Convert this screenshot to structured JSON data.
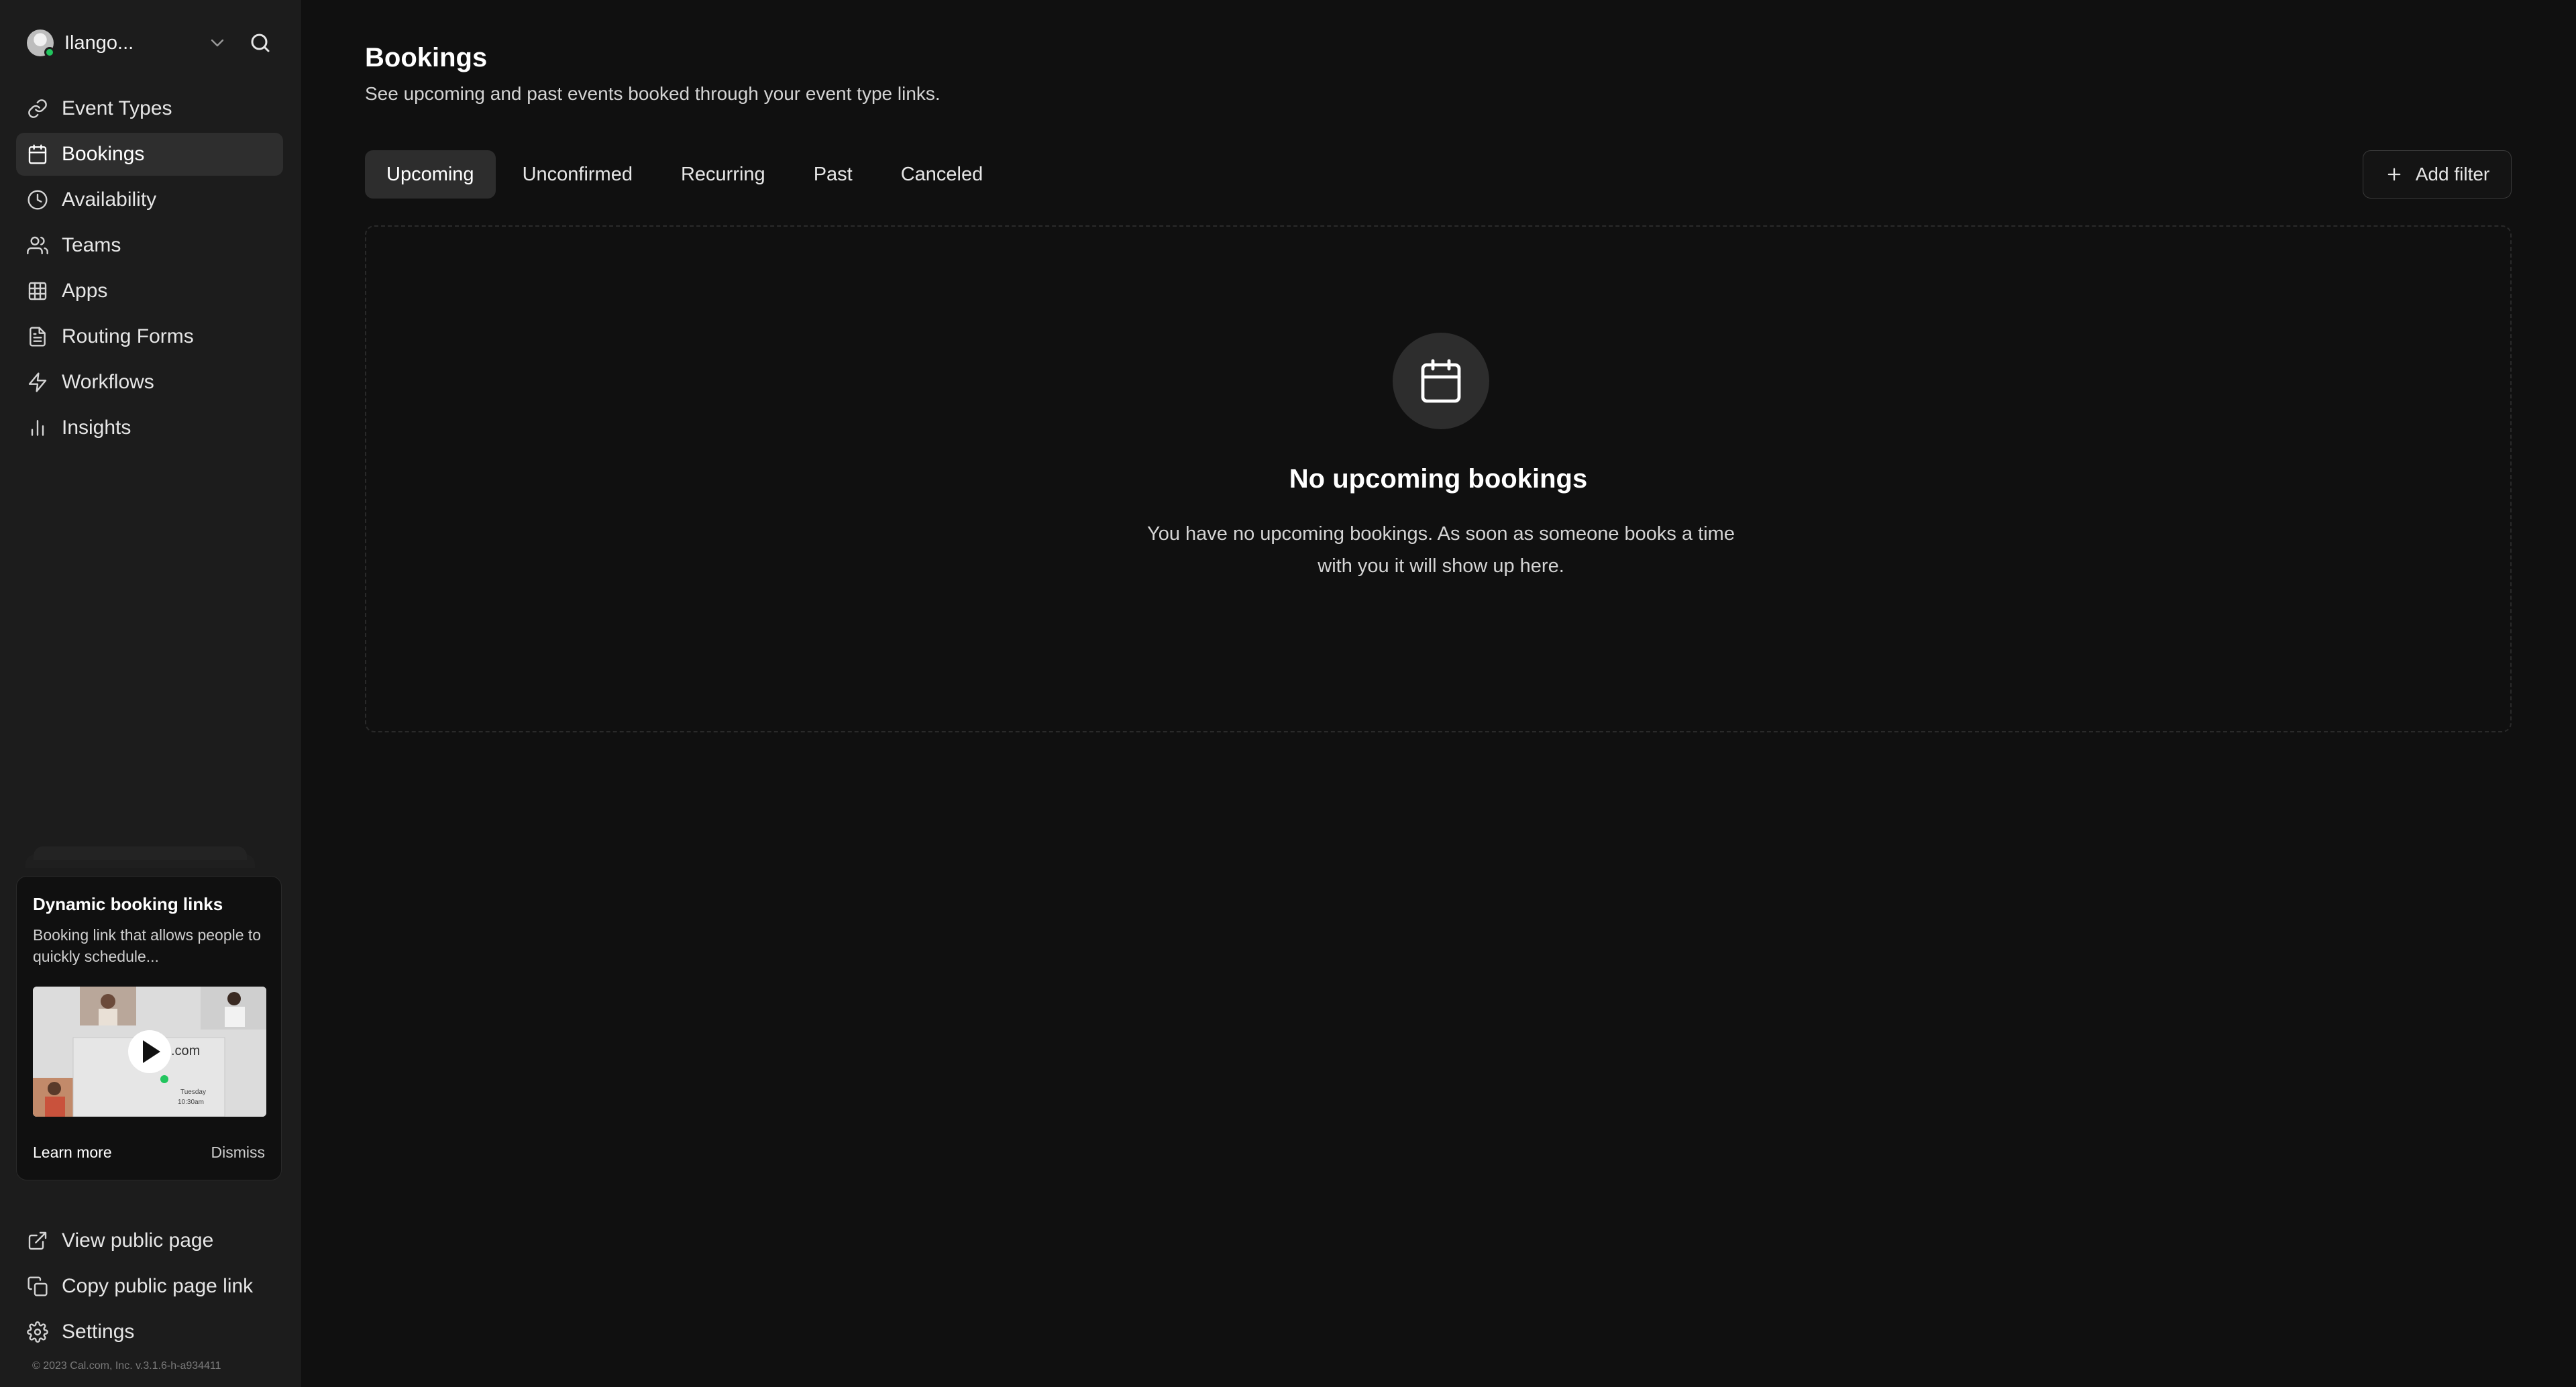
{
  "user": {
    "name": "Ilango...",
    "status_color": "#22c55e"
  },
  "sidebar": {
    "items": [
      {
        "label": "Event Types",
        "icon": "link-icon"
      },
      {
        "label": "Bookings",
        "icon": "calendar-icon",
        "active": true
      },
      {
        "label": "Availability",
        "icon": "clock-icon"
      },
      {
        "label": "Teams",
        "icon": "users-icon"
      },
      {
        "label": "Apps",
        "icon": "grid-icon"
      },
      {
        "label": "Routing Forms",
        "icon": "file-icon"
      },
      {
        "label": "Workflows",
        "icon": "zap-icon"
      },
      {
        "label": "Insights",
        "icon": "bar-chart-icon"
      }
    ],
    "bottom_items": [
      {
        "label": "View public page",
        "icon": "external-link-icon"
      },
      {
        "label": "Copy public page link",
        "icon": "copy-icon"
      },
      {
        "label": "Settings",
        "icon": "gear-icon"
      }
    ],
    "footer_note": "© 2023 Cal.com, Inc. v.3.1.6-h-a934411"
  },
  "promo": {
    "title": "Dynamic booking links",
    "description": "Booking link that allows people to quickly schedule...",
    "video_text": ".com",
    "video_day": "Tuesday",
    "video_time": "10:30am",
    "learn_more": "Learn more",
    "dismiss": "Dismiss"
  },
  "main": {
    "title": "Bookings",
    "subtitle": "See upcoming and past events booked through your event type links.",
    "tabs": [
      {
        "label": "Upcoming",
        "active": true
      },
      {
        "label": "Unconfirmed"
      },
      {
        "label": "Recurring"
      },
      {
        "label": "Past"
      },
      {
        "label": "Canceled"
      }
    ],
    "add_filter": "Add filter",
    "empty_state": {
      "title": "No upcoming bookings",
      "description": "You have no upcoming bookings. As soon as someone books a time with you it will show up here."
    }
  },
  "colors": {
    "background": "#101010",
    "sidebar": "#1c1c1c",
    "active_tab": "#2d2d2d"
  }
}
